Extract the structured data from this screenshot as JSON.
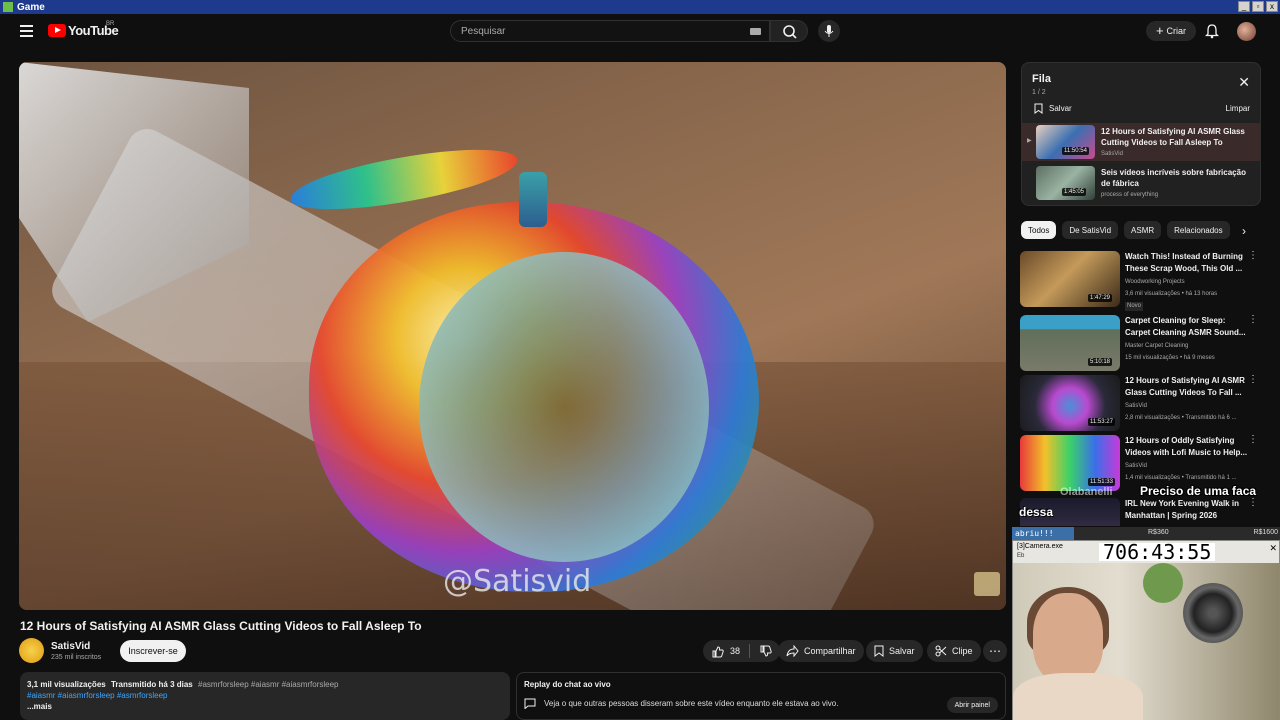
{
  "window": {
    "title": "Game"
  },
  "header": {
    "logo_text": "YouTube",
    "logo_region": "BR",
    "search_placeholder": "Pesquisar",
    "create_label": "Criar"
  },
  "player": {
    "watermark": "@Satisvid"
  },
  "video": {
    "title": "12 Hours of Satisfying AI ASMR Glass Cutting Videos to Fall Asleep To",
    "channel": "SatisVid",
    "subscribers": "235 mil inscritos",
    "subscribe_label": "Inscrever-se",
    "likes": "38",
    "share_label": "Compartilhar",
    "save_label": "Salvar",
    "clip_label": "Clipe"
  },
  "description": {
    "views": "3,1 mil visualizações",
    "date": "Transmitido há 3 dias",
    "tags1": "#asmrforsleep #aiasmr #aiasmrforsleep",
    "tags2": "#aiasmr #aiasmrforsleep #asmrforsleep",
    "more": "...mais"
  },
  "chat_replay": {
    "title": "Replay do chat ao vivo",
    "desc": "Veja o que outras pessoas disseram sobre este vídeo enquanto ele estava ao vivo.",
    "button": "Abrir painel"
  },
  "queue": {
    "title": "Fila",
    "count": "1 / 2",
    "save": "Salvar",
    "clear": "Limpar",
    "items": [
      {
        "title": "12 Hours of Satisfying AI ASMR Glass Cutting Videos to Fall Asleep To",
        "channel": "SatisVid",
        "duration": "11:50:54"
      },
      {
        "title": "Seis vídeos incríveis sobre fabricação de fábrica",
        "channel": "process of everything",
        "duration": "1:45:05"
      }
    ]
  },
  "chips": [
    "Todos",
    "De SatisVid",
    "ASMR",
    "Relacionados"
  ],
  "recommendations": [
    {
      "title": "Watch This! Instead of Burning These Scrap Wood, This Old ...",
      "channel": "Woodworking Projects",
      "meta": "3,6 mil visualizações • há 13 horas",
      "badge": "Novo",
      "duration": "1:47:29"
    },
    {
      "title": "Carpet Cleaning for Sleep: Carpet Cleaning ASMR Sound...",
      "channel": "Master Carpet Cleaning",
      "meta": "15 mil visualizações • há 9 meses",
      "badge": "",
      "duration": "5:10:18"
    },
    {
      "title": "12 Hours of Satisfying AI ASMR Glass Cutting Videos To Fall ...",
      "channel": "SatisVid",
      "meta": "2,8 mil visualizações • Transmitido há 6 ...",
      "badge": "",
      "duration": "11:53:27"
    },
    {
      "title": "12 Hours of Oddly Satisfying Videos with Lofi Music to Help...",
      "channel": "SatisVid",
      "meta": "1,4 mil visualizações • Transmitido há 1 ...",
      "badge": "",
      "duration": "11:51:33"
    },
    {
      "title": "IRL New York Evening Walk in Manhattan | Spring 2026",
      "channel": "",
      "meta": "",
      "badge": "",
      "duration": ""
    }
  ],
  "stream_overlay": {
    "user": "Olabanelli",
    "message1": "Preciso de uma faca",
    "message2": "dessa",
    "goal_label": "abriu!!!",
    "goal_mid": "R$360",
    "goal_end": "R$1600",
    "goal_progress": 0.23,
    "cam_window": "[3]Camera.exe",
    "cam_sub": "Eb",
    "timer": "706:43:55"
  },
  "colors": {
    "accent": "#ff0000",
    "background": "#0f0f0f",
    "link": "#3ea6ff"
  }
}
